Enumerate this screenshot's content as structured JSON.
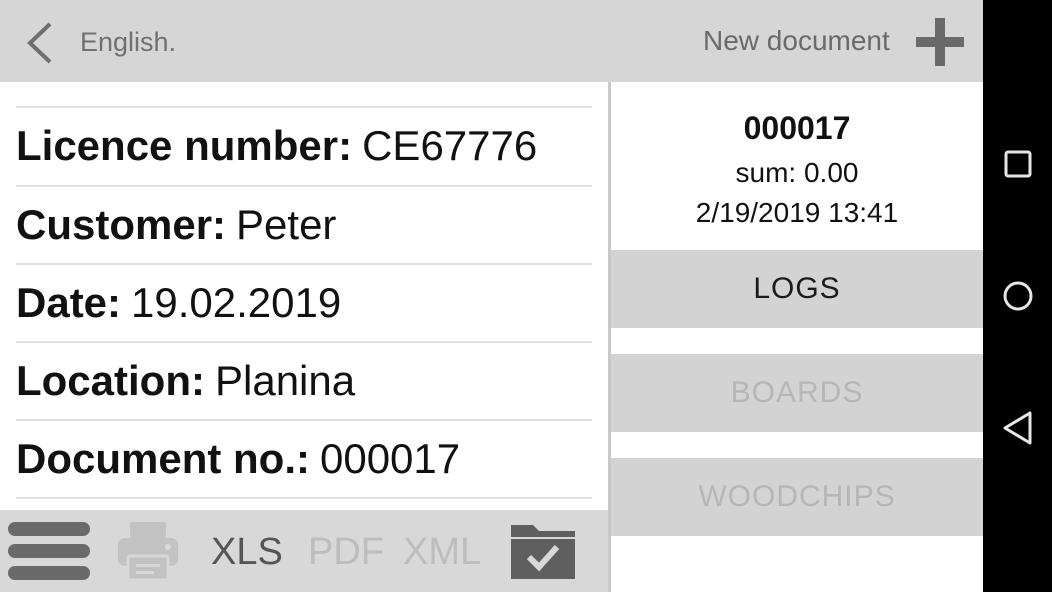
{
  "header": {
    "back_icon": "chevron-left-icon",
    "language": "English.",
    "new_document": "New document",
    "add_icon": "plus-icon"
  },
  "fields": [
    {
      "label": "Licence number:",
      "value": "CE67776"
    },
    {
      "label": "Customer:",
      "value": "Peter"
    },
    {
      "label": "Date:",
      "value": "19.02.2019"
    },
    {
      "label": "Location:",
      "value": "Planina"
    },
    {
      "label": "Document no.:",
      "value": "000017"
    }
  ],
  "toolbar": {
    "menu_icon": "hamburger-menu-icon",
    "print_icon": "printer-icon",
    "xls": "XLS",
    "pdf": "PDF",
    "xml": "XML",
    "folder_icon": "folder-check-icon"
  },
  "summary": {
    "document_number": "000017",
    "sum": "sum: 0.00",
    "timestamp": "2/19/2019 13:41"
  },
  "buttons": {
    "logs": "LOGS",
    "boards": "BOARDS",
    "woodchips": "WOODCHIPS"
  },
  "colors": {
    "bar_gray": "#d6d6d6",
    "enabled_text": "#1b1b1b",
    "disabled_text": "#b6b6b6",
    "icon_gray": "#6a6a6a"
  }
}
